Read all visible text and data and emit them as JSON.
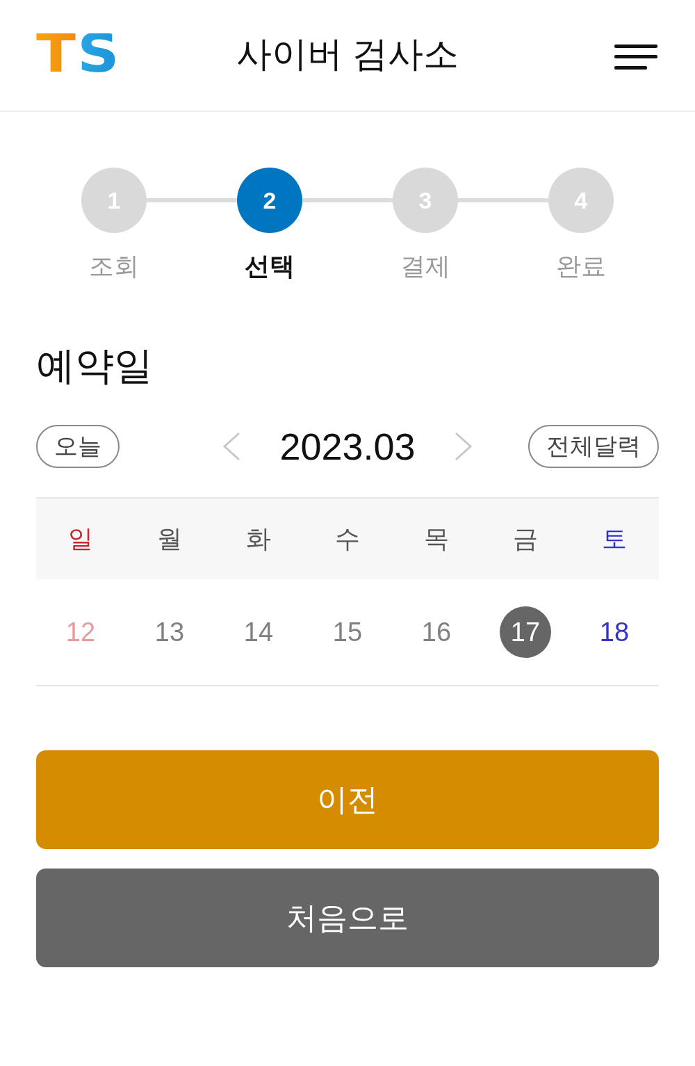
{
  "header": {
    "logo": "TS",
    "title": "사이버 검사소"
  },
  "steps": [
    {
      "number": "1",
      "label": "조회",
      "selected": false
    },
    {
      "number": "2",
      "label": "선택",
      "selected": true
    },
    {
      "number": "3",
      "label": "결제",
      "selected": false
    },
    {
      "number": "4",
      "label": "완료",
      "selected": false
    }
  ],
  "section_title": "예약일",
  "date_nav": {
    "today_button": "오늘",
    "month": "2023.03",
    "calendar_button": "전체달력"
  },
  "calendar": {
    "weekdays": [
      {
        "label": "일",
        "color": "#c8262e"
      },
      {
        "label": "월",
        "color": "#555555"
      },
      {
        "label": "화",
        "color": "#555555"
      },
      {
        "label": "수",
        "color": "#555555"
      },
      {
        "label": "목",
        "color": "#555555"
      },
      {
        "label": "금",
        "color": "#555555"
      },
      {
        "label": "토",
        "color": "#3333c4"
      }
    ],
    "dates": [
      {
        "label": "12",
        "color": "#e89a9c",
        "selected": false
      },
      {
        "label": "13",
        "color": "#808080",
        "selected": false
      },
      {
        "label": "14",
        "color": "#808080",
        "selected": false
      },
      {
        "label": "15",
        "color": "#808080",
        "selected": false
      },
      {
        "label": "16",
        "color": "#808080",
        "selected": false
      },
      {
        "label": "17",
        "color": "#666666",
        "selected": true
      },
      {
        "label": "18",
        "color": "#3333c4",
        "selected": false
      }
    ]
  },
  "buttons": [
    {
      "label": "이전",
      "kind": "primary"
    },
    {
      "label": "처음으로",
      "kind": "secondary"
    }
  ]
}
